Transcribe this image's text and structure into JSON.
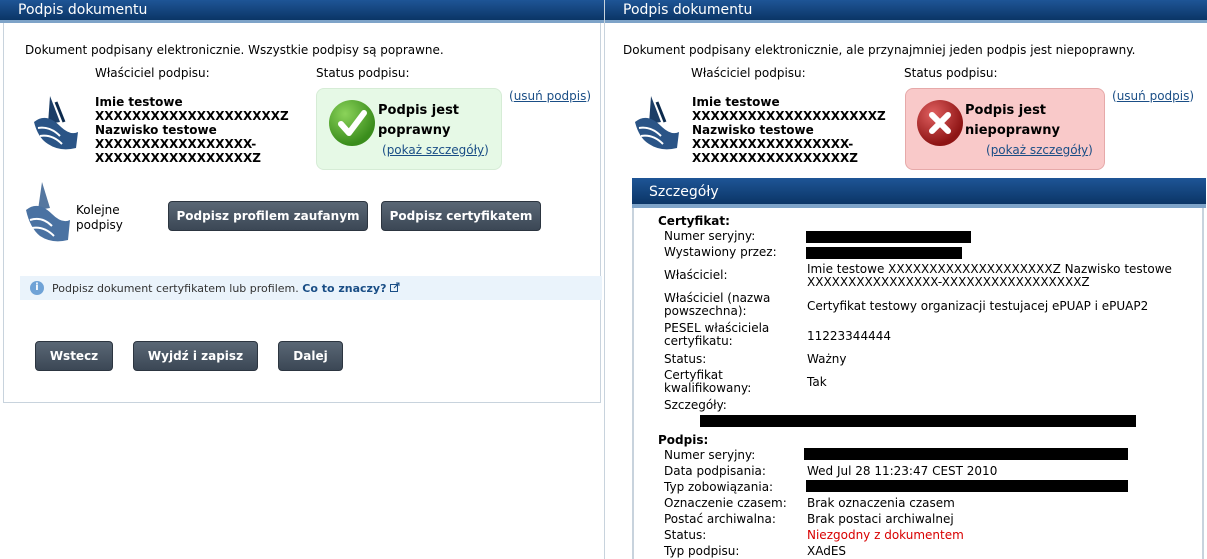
{
  "left": {
    "title": "Podpis dokumentu",
    "message": "Dokument podpisany elektronicznie. Wszystkie podpisy są poprawne.",
    "owner_header": "Właściciel podpisu:",
    "status_header": "Status podpisu:",
    "owner_lines": [
      "Imie testowe",
      "XXXXXXXXXXXXXXXXXXXXZ",
      "Nazwisko testowe",
      "XXXXXXXXXXXXXXXXX-",
      "XXXXXXXXXXXXXXXXXZ"
    ],
    "status_line1": "Podpis jest",
    "status_line2": "poprawny",
    "details_link": "pokaż szczegóły",
    "remove_link": "usuń podpis",
    "next_sigs_line1": "Kolejne",
    "next_sigs_line2": "podpisy",
    "btn_profile": "Podpisz profilem zaufanym",
    "btn_cert": "Podpisz certyfikatem",
    "info_text": "Podpisz dokument certyfikatem lub profilem.",
    "info_link": "Co to znaczy?",
    "btn_back": "Wstecz",
    "btn_save": "Wyjdź i zapisz",
    "btn_next": "Dalej"
  },
  "right": {
    "title": "Podpis dokumentu",
    "message": "Dokument podpisany elektronicznie, ale przynajmniej jeden podpis jest niepoprawny.",
    "owner_header": "Właściciel podpisu:",
    "status_header": "Status podpisu:",
    "owner_lines": [
      "Imie testowe",
      "XXXXXXXXXXXXXXXXXXXXZ",
      "Nazwisko testowe",
      "XXXXXXXXXXXXXXXXX-",
      "XXXXXXXXXXXXXXXXXZ"
    ],
    "status_line1": "Podpis jest",
    "status_line2": "niepoprawny",
    "details_link": "pokaż szczegóły",
    "remove_link": "usuń podpis"
  },
  "details": {
    "title": "Szczegóły",
    "cert_title": "Certyfikat:",
    "serial_label": "Numer seryjny:",
    "issued_label": "Wystawiony przez:",
    "owner_label": "Właściciel:",
    "owner_value_1": "Imie testowe XXXXXXXXXXXXXXXXXXXXZ Nazwisko testowe",
    "owner_value_2": "XXXXXXXXXXXXXXXX-XXXXXXXXXXXXXXXXXZ",
    "common_label_1": "Właściciel (nazwa",
    "common_label_2": "powszechna):",
    "common_value": "Certyfikat testowy organizacji testujacej ePUAP i ePUAP2",
    "pesel_label_1": "PESEL właściciela",
    "pesel_label_2": "certyfikatu:",
    "pesel_value": "11223344444",
    "status_label": "Status:",
    "status_value": "Ważny",
    "qualified_label_1": "Certyfikat",
    "qualified_label_2": "kwalifikowany:",
    "qualified_value": "Tak",
    "details_label": "Szczegóły:",
    "sig_title": "Podpis:",
    "sig_serial_label": "Numer seryjny:",
    "sig_date_label": "Data podpisania:",
    "sig_date_value": "Wed Jul 28 11:23:47 CEST 2010",
    "sig_type_label": "Typ zobowiązania:",
    "sig_ts_label": "Oznaczenie czasem:",
    "sig_ts_value": "Brak oznaczenia czasem",
    "sig_arch_label": "Postać archiwalna:",
    "sig_arch_value": "Brak postaci archiwalnej",
    "sig_status_label": "Status:",
    "sig_status_value": "Niezgodny z dokumentem",
    "sig_kind_label": "Typ podpisu:",
    "sig_kind_value": "XAdES"
  },
  "colors": {
    "header_blue": "#0f3d72",
    "link_blue": "#1a4e86",
    "ok_bg": "#e6f9e6",
    "bad_bg": "#f9c9c9",
    "error_red": "#d80000"
  }
}
